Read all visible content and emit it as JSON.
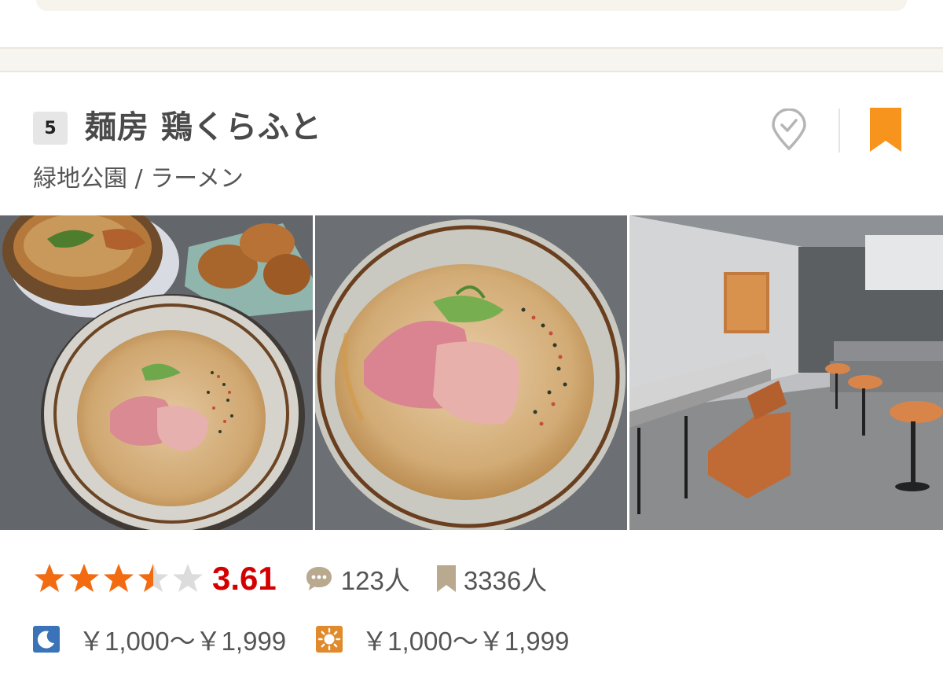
{
  "restaurant": {
    "rank": "5",
    "name": "麺房 鶏くらふと",
    "area_genre": "緑地公園 / ラーメン",
    "bookmark_color": "#f7941d"
  },
  "photos": [
    {
      "name": "ramen-and-karaage-photo"
    },
    {
      "name": "ramen-closeup-photo"
    },
    {
      "name": "restaurant-interior-photo"
    }
  ],
  "rating": {
    "score": "3.61",
    "stars": 3.5,
    "max_stars": 5,
    "star_color": "#f26b10",
    "score_color": "#d40000",
    "reviews": "123人",
    "saves": "3336人"
  },
  "prices": {
    "dinner": "￥1,000～￥1,999",
    "lunch": "￥1,000～￥1,999",
    "dinner_icon": "moon-icon",
    "lunch_icon": "sun-icon",
    "dinner_icon_color": "#3b73b8",
    "lunch_icon_color": "#e08a2c"
  }
}
